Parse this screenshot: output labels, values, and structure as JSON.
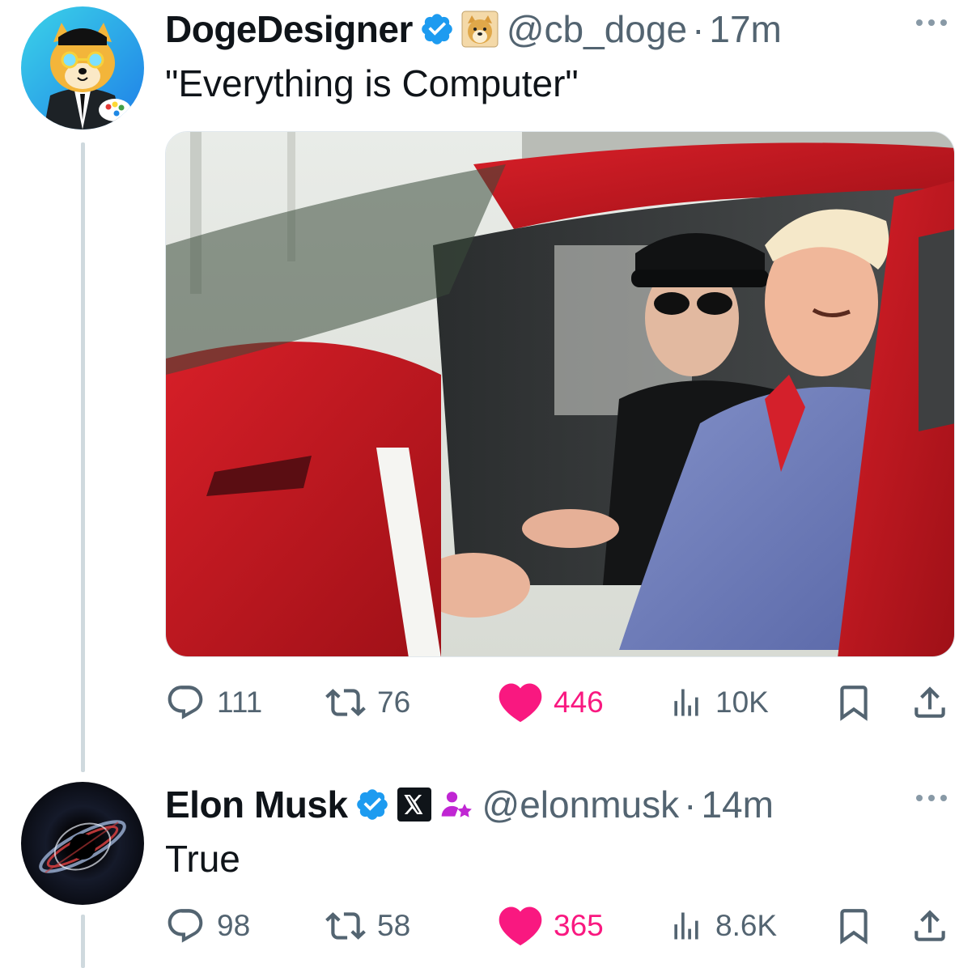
{
  "tweets": [
    {
      "name": "DogeDesigner",
      "handle": "@cb_doge",
      "separator": "·",
      "time": "17m",
      "text": "\"Everything is Computer\"",
      "media_alt": "Elon Musk and Donald Trump sitting in a red Tesla",
      "stats": {
        "replies": "111",
        "reposts": "76",
        "likes": "446",
        "views": "10K"
      }
    },
    {
      "name": "Elon Musk",
      "handle": "@elonmusk",
      "separator": "·",
      "time": "14m",
      "text": "True",
      "stats": {
        "replies": "98",
        "reposts": "58",
        "likes": "365",
        "views": "8.6K"
      }
    }
  ],
  "icons": {
    "verified": "verified-badge-icon",
    "affiliate_doge": "doge-affiliate-icon",
    "affiliate_x": "x-affiliate-icon",
    "subscriber": "person-star-icon",
    "reply": "reply-icon",
    "repost": "repost-icon",
    "like": "heart-icon",
    "views": "views-bar-icon",
    "bookmark": "bookmark-icon",
    "share": "share-icon",
    "more": "more-dots-icon"
  },
  "colors": {
    "verified": "#1d9bf0",
    "like": "#f91880",
    "secondary_text": "#536471",
    "subscriber": "#c026d3"
  }
}
